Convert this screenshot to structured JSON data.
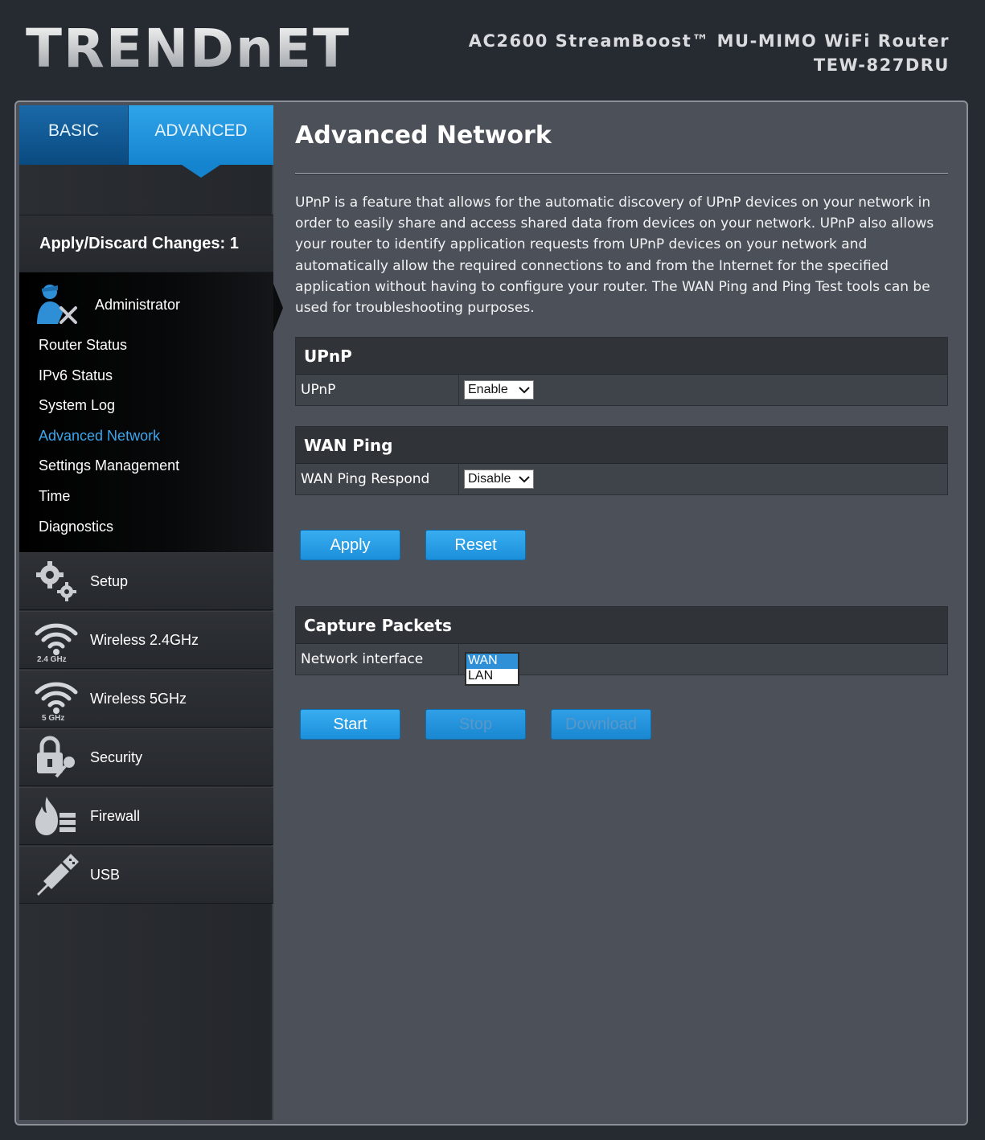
{
  "header": {
    "logo": "TRENDnET",
    "product_line1": "AC2600 StreamBoost™ MU-MIMO WiFi Router",
    "product_line2": "TEW-827DRU"
  },
  "tabs": {
    "basic": "BASIC",
    "advanced": "ADVANCED",
    "active": "advanced"
  },
  "sidebar": {
    "apply_changes": "Apply/Discard Changes: 1",
    "admin": {
      "label": "Administrator",
      "icon": "administrator-icon",
      "items": [
        {
          "label": "Router Status",
          "active": false
        },
        {
          "label": "IPv6 Status",
          "active": false
        },
        {
          "label": "System Log",
          "active": false
        },
        {
          "label": "Advanced Network",
          "active": true
        },
        {
          "label": "Settings Management",
          "active": false
        },
        {
          "label": "Time",
          "active": false
        },
        {
          "label": "Diagnostics",
          "active": false
        }
      ]
    },
    "nav": [
      {
        "label": "Setup",
        "icon": "gears-icon",
        "sub": ""
      },
      {
        "label": "Wireless 2.4GHz",
        "icon": "wifi-icon",
        "sub": "2.4 GHz"
      },
      {
        "label": "Wireless 5GHz",
        "icon": "wifi-icon",
        "sub": "5 GHz"
      },
      {
        "label": "Security",
        "icon": "lock-key-icon",
        "sub": ""
      },
      {
        "label": "Firewall",
        "icon": "firewall-icon",
        "sub": ""
      },
      {
        "label": "USB",
        "icon": "usb-icon",
        "sub": ""
      }
    ]
  },
  "main": {
    "title": "Advanced Network",
    "description": "UPnP is a feature that allows for the automatic discovery of UPnP devices on your network in order to easily share and access shared data from devices on your network. UPnP also allows your router to identify application requests from UPnP devices on your network and automatically allow the required connections to and from the Internet for the specified application without having to configure your router. The WAN Ping and Ping Test tools can be used for troubleshooting purposes.",
    "upnp": {
      "heading": "UPnP",
      "label": "UPnP",
      "value": "Enable"
    },
    "wan_ping": {
      "heading": "WAN Ping",
      "label": "WAN Ping Respond",
      "value": "Disable"
    },
    "buttons": {
      "apply": "Apply",
      "reset": "Reset"
    },
    "capture": {
      "heading": "Capture Packets",
      "label": "Network interface",
      "options": [
        "WAN",
        "LAN"
      ],
      "selected": "WAN"
    },
    "capture_buttons": {
      "start": "Start",
      "stop": "Stop",
      "download": "Download"
    }
  },
  "colors": {
    "accent": "#1c8fdb",
    "active_link": "#3aa6ee",
    "background": "#4c5058"
  }
}
